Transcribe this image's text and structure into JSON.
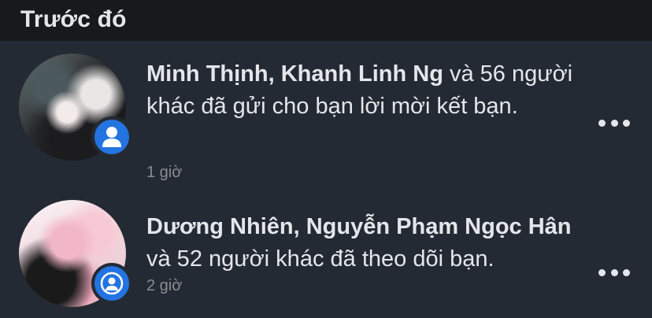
{
  "section": {
    "title": "Trước đó"
  },
  "notifications": [
    {
      "actor_1": "Minh Thịnh,",
      "actor_2": "Khanh Linh Ng",
      "text": " và 56 người khác đã gửi cho bạn lời mời kết bạn.",
      "time": "1 giờ",
      "badge_icon": "person-icon"
    },
    {
      "actor_1": "Dương Nhiên,",
      "actor_2": "Nguyễn Phạm Ngọc Hân",
      "text": " và 52 người khác đã theo dõi bạn.",
      "time": "2 giờ",
      "badge_icon": "person-circle-icon"
    }
  ],
  "colors": {
    "background": "#242a33",
    "header_background": "#18191a",
    "badge": "#2374e1",
    "text": "#e4e6eb",
    "secondary_text": "#8a8d91"
  }
}
